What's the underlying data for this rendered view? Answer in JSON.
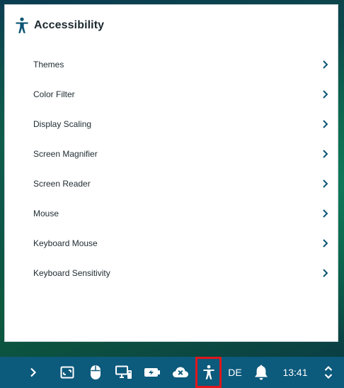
{
  "panel": {
    "title": "Accessibility",
    "icon": "accessibility-icon",
    "items": [
      {
        "label": "Themes"
      },
      {
        "label": "Color Filter"
      },
      {
        "label": "Display Scaling"
      },
      {
        "label": "Screen Magnifier"
      },
      {
        "label": "Screen Reader"
      },
      {
        "label": "Mouse"
      },
      {
        "label": "Keyboard Mouse"
      },
      {
        "label": "Keyboard Sensitivity"
      }
    ]
  },
  "taskbar": {
    "icons": [
      "chevron-right-icon",
      "screen-area-icon",
      "mouse-icon",
      "display-computer-icon",
      "battery-icon",
      "cloud-error-icon",
      "accessibility-icon",
      "bell-icon",
      "chevron-up-down-icon"
    ],
    "language": "DE",
    "clock": "13:41",
    "highlight_color": "#e0161b",
    "background_color": "#0c5a7c"
  },
  "colors": {
    "accent": "#0b5575",
    "text": "#1d2a30"
  }
}
